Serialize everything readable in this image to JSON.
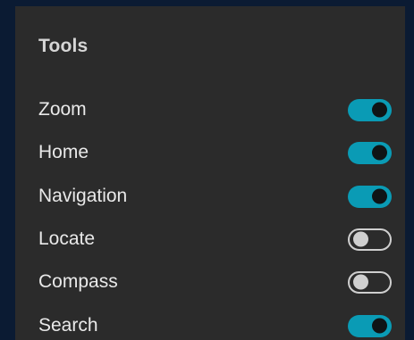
{
  "panel": {
    "title": "Tools",
    "items": [
      {
        "label": "Zoom",
        "enabled": true
      },
      {
        "label": "Home",
        "enabled": true
      },
      {
        "label": "Navigation",
        "enabled": true
      },
      {
        "label": "Locate",
        "enabled": false
      },
      {
        "label": "Compass",
        "enabled": false
      },
      {
        "label": "Search",
        "enabled": true
      }
    ]
  },
  "colors": {
    "background": "#0b1b33",
    "panel": "#2b2b2b",
    "toggle_on": "#0a9bb5",
    "toggle_off_outline": "#cfcfcf"
  }
}
